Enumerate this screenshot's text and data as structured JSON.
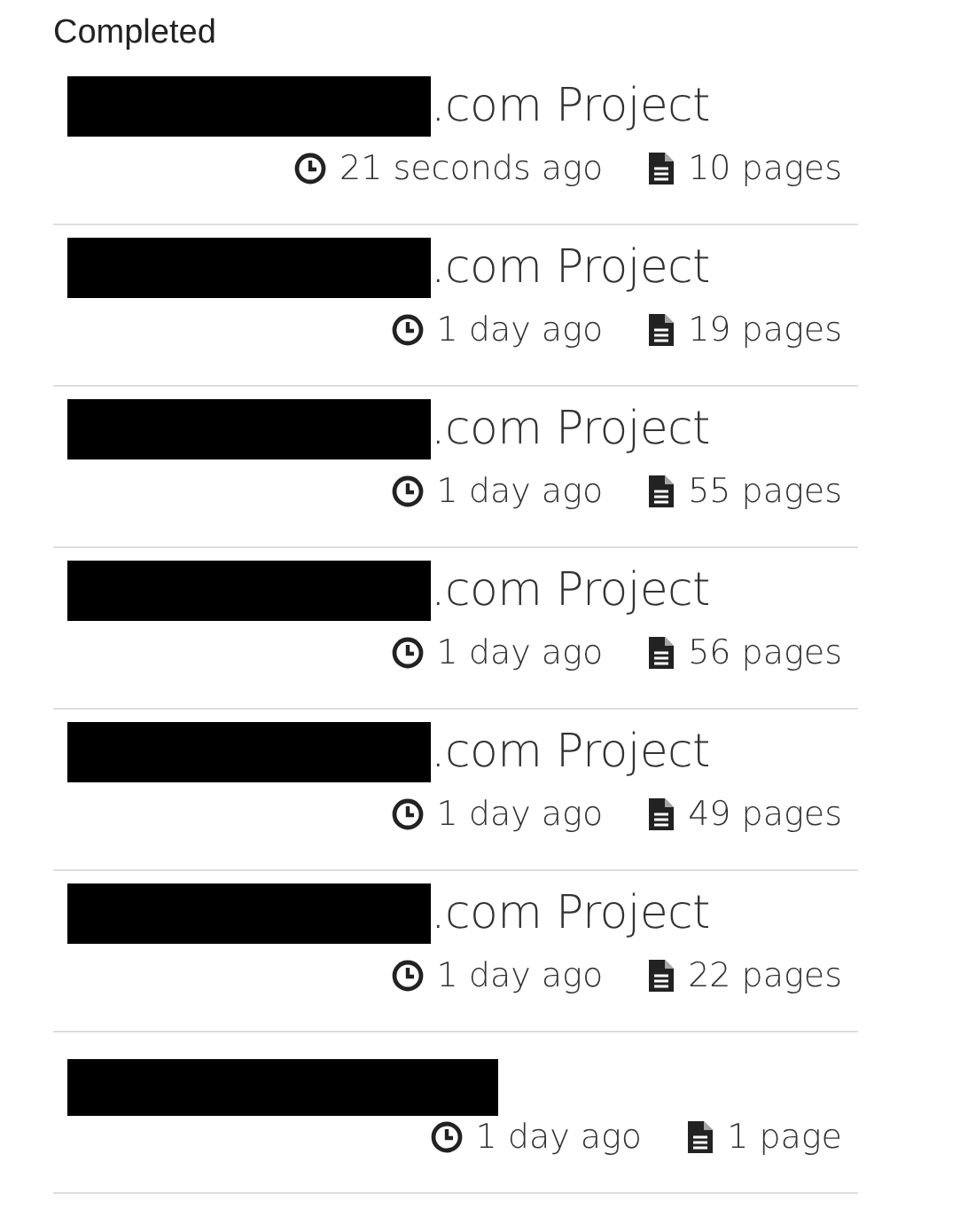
{
  "heading": "Completed",
  "projects": [
    {
      "redacted": true,
      "title": ".com Project",
      "time": "21 seconds ago",
      "pages": "10 pages"
    },
    {
      "redacted": true,
      "title": ".com Project",
      "time": "1 day ago",
      "pages": "19 pages"
    },
    {
      "redacted": true,
      "title": ".com Project",
      "time": "1 day ago",
      "pages": "55 pages"
    },
    {
      "redacted": true,
      "title": ".com Project",
      "time": "1 day ago",
      "pages": "56 pages"
    },
    {
      "redacted": true,
      "title": ".com Project",
      "time": "1 day ago",
      "pages": "49 pages"
    },
    {
      "redacted": true,
      "title": ".com Project",
      "time": "1 day ago",
      "pages": "22 pages"
    },
    {
      "redacted": true,
      "time": "1 day ago",
      "pages": "1 page"
    }
  ]
}
